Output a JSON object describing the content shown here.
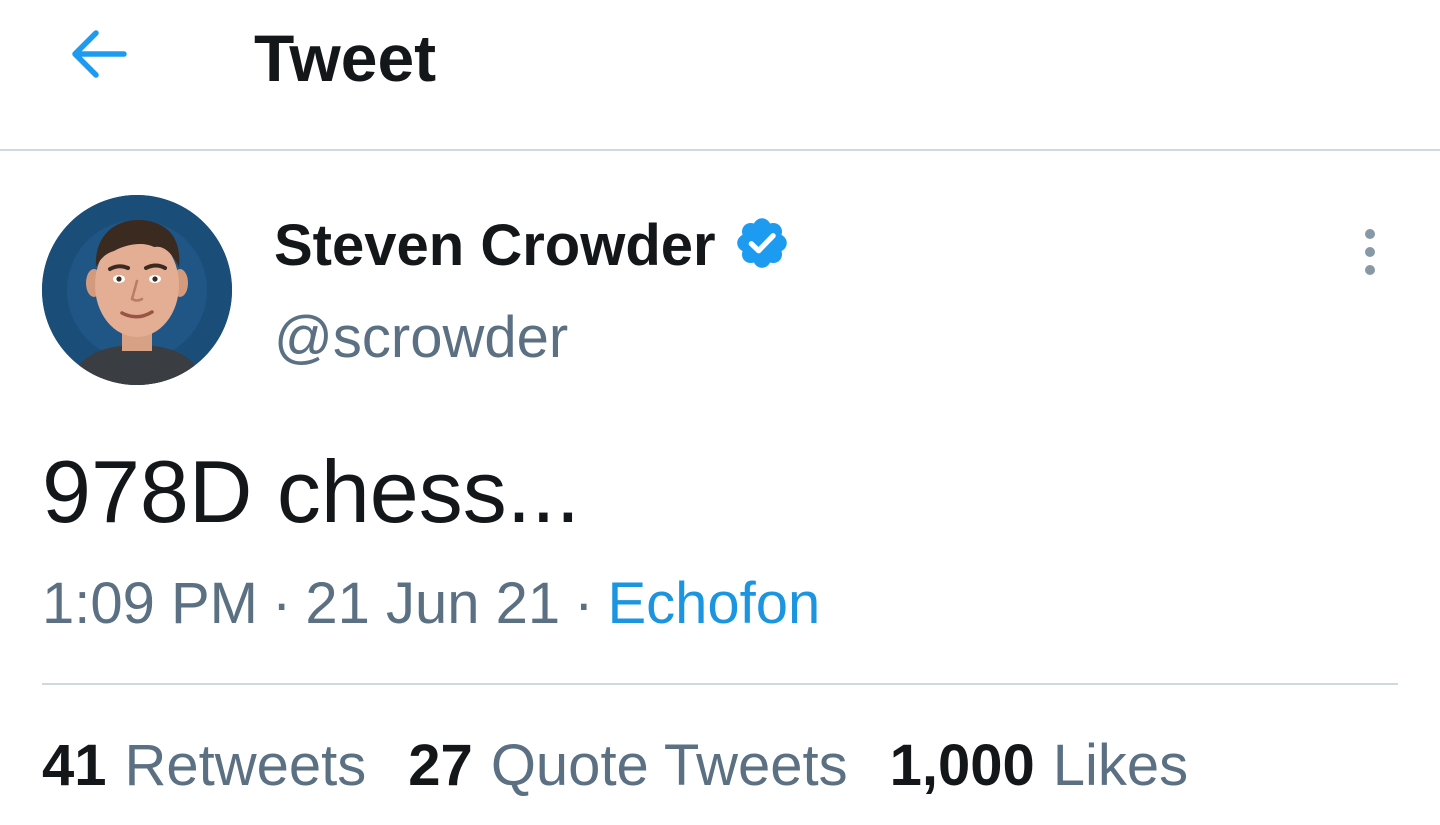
{
  "header": {
    "title": "Tweet",
    "back_icon": "arrow-left-icon"
  },
  "author": {
    "display_name": "Steven Crowder",
    "handle": "@scrowder",
    "verified": true,
    "verified_icon": "verified-badge-icon"
  },
  "tweet": {
    "text": "978D chess...",
    "time": "1:09 PM",
    "date": "21 Jun 21",
    "source": "Echofon",
    "separator": "·"
  },
  "stats": {
    "retweets": {
      "count": "41",
      "label": "Retweets"
    },
    "quote_tweets": {
      "count": "27",
      "label": "Quote Tweets"
    },
    "likes": {
      "count": "1,000",
      "label": "Likes"
    }
  },
  "colors": {
    "accent": "#1d9bf0",
    "source_link": "#1b95e0",
    "secondary_text": "#5b7083",
    "primary_text": "#14171a",
    "divider": "#cfd9de"
  }
}
